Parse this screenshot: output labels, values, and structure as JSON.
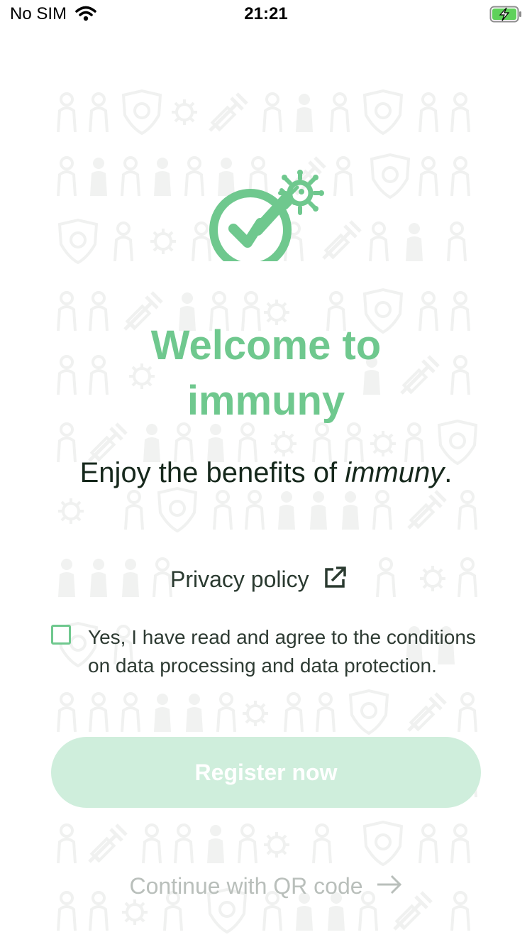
{
  "status_bar": {
    "carrier": "No SIM",
    "time": "21:21"
  },
  "welcome": {
    "title_line1": "Welcome to",
    "title_line2": "immuny",
    "subtitle_prefix": "Enjoy the benefits of ",
    "subtitle_brand": "immuny",
    "subtitle_suffix": "."
  },
  "privacy": {
    "link_label": "Privacy policy"
  },
  "consent": {
    "text": "Yes, I have read and agree to the conditions on data processing and data protection.",
    "checked": false
  },
  "actions": {
    "register_label": "Register now",
    "qr_label": "Continue with QR code"
  },
  "colors": {
    "brand_green": "#6fc88e",
    "button_disabled": "#cfeedc",
    "text_dark": "#16281c",
    "muted_text": "#b9bfbb"
  },
  "icons": {
    "logo": "vaccine-check-logo",
    "privacy": "external-link-icon",
    "qr": "arrow-right-icon"
  }
}
